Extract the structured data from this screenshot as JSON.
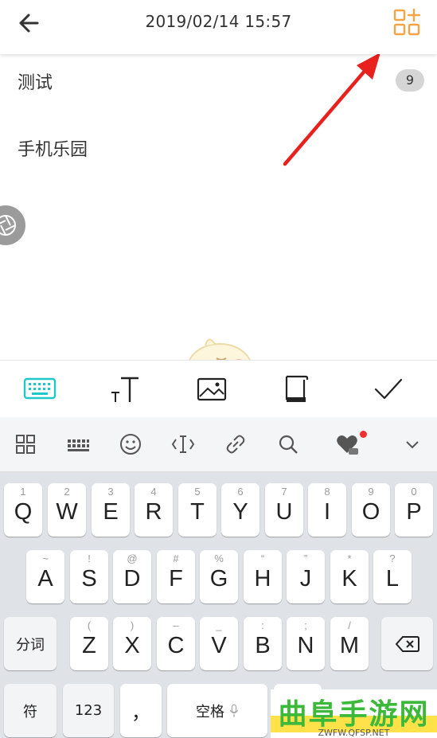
{
  "header": {
    "title": "2019/02/14 15:57",
    "back_icon": "arrow-left-icon",
    "add_icon": "grid-add-icon",
    "accent_color": "#f5a343"
  },
  "note": {
    "lines": [
      "测试",
      "手机乐园"
    ],
    "badge_count": "9"
  },
  "annotation": {
    "arrow_color": "#e8201e"
  },
  "edit_toolbar": {
    "items": [
      "keyboard-icon",
      "text-size-icon",
      "image-icon",
      "notebook-icon",
      "check-icon"
    ],
    "active_color": "#1ec8c8"
  },
  "keyboard_tools": [
    "apps-grid-icon",
    "keyboard-layout-icon",
    "emoji-icon",
    "cursor-icon",
    "link-icon",
    "search-icon",
    "heart-ad-icon",
    "chevron-down-icon"
  ],
  "keyboard": {
    "row1": [
      {
        "sub": "1",
        "main": "Q"
      },
      {
        "sub": "2",
        "main": "W"
      },
      {
        "sub": "3",
        "main": "E"
      },
      {
        "sub": "4",
        "main": "R"
      },
      {
        "sub": "5",
        "main": "T"
      },
      {
        "sub": "6",
        "main": "Y"
      },
      {
        "sub": "7",
        "main": "U"
      },
      {
        "sub": "8",
        "main": "I"
      },
      {
        "sub": "9",
        "main": "O"
      },
      {
        "sub": "0",
        "main": "P"
      }
    ],
    "row2": [
      {
        "sub": "~",
        "main": "A"
      },
      {
        "sub": "!",
        "main": "S"
      },
      {
        "sub": "@",
        "main": "D"
      },
      {
        "sub": "#",
        "main": "F"
      },
      {
        "sub": "%",
        "main": "G"
      },
      {
        "sub": "“",
        "main": "H"
      },
      {
        "sub": "”",
        "main": "J"
      },
      {
        "sub": "*",
        "main": "K"
      },
      {
        "sub": "?",
        "main": "L"
      }
    ],
    "row3": [
      {
        "sub": "(",
        "main": "Z"
      },
      {
        "sub": ")",
        "main": "X"
      },
      {
        "sub": "–",
        "main": "C"
      },
      {
        "sub": "_",
        "main": "V"
      },
      {
        "sub": ":",
        "main": "B"
      },
      {
        "sub": ";",
        "main": "N"
      },
      {
        "sub": "/",
        "main": "M"
      }
    ],
    "segment_label": "分词",
    "symbol_label": "符",
    "num_label": "123",
    "comma_label": "，",
    "space_label": "空格"
  },
  "watermark": {
    "title": "曲阜手游网",
    "url": "ZWFW.QFSP.NET"
  }
}
